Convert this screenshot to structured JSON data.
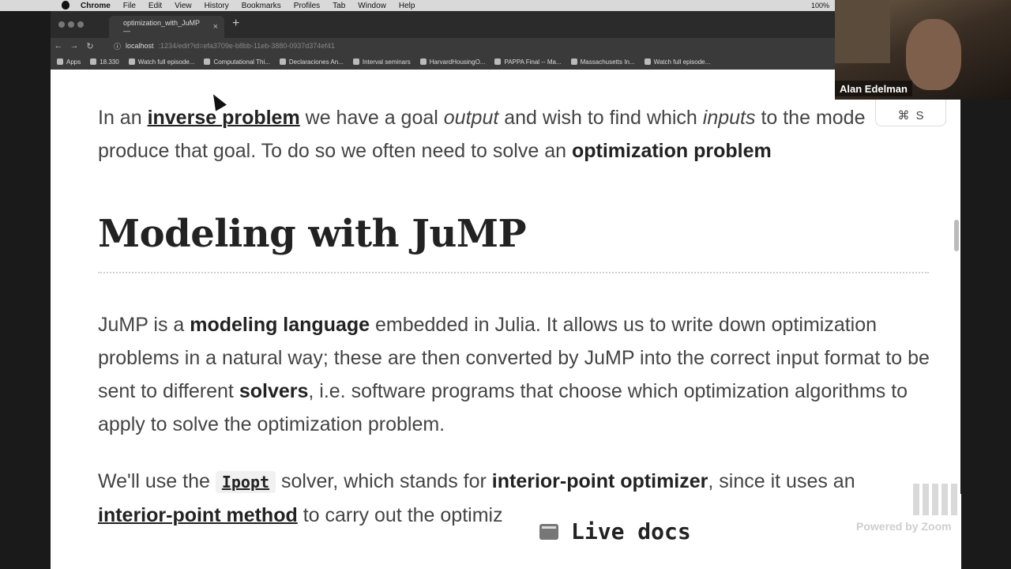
{
  "menubar": {
    "app_name": "Chrome",
    "items": [
      "File",
      "Edit",
      "View",
      "History",
      "Bookmarks",
      "Profiles",
      "Tab",
      "Window",
      "Help"
    ],
    "battery": "100%"
  },
  "tab": {
    "title": "optimization_with_JuMP —",
    "close": "×"
  },
  "new_tab": "+",
  "address": {
    "host": "localhost",
    "rest": ":1234/edit?id=efa3709e-b8bb-11eb-3880-0937d374ef41"
  },
  "bookmarks": [
    "Apps",
    "18.330",
    "Watch full episode...",
    "Computational Thi...",
    "Declaraciones An...",
    "Interval seminars",
    "HarvardHousingO...",
    "PAPPA Final -- Ma...",
    "Massachusetts In...",
    "Watch full episode..."
  ],
  "content": {
    "p1": {
      "t1": "In an ",
      "link1": "inverse problem",
      "t2": " we have a goal ",
      "i1": "output",
      "t3": " and wish to find which ",
      "i2": "inputs",
      "t4": " to the mode",
      "t5": "produce that goal. To do so we often need to solve an ",
      "b1": "optimization problem"
    },
    "heading": "Modeling with JuMP",
    "p2": {
      "t1": "JuMP is a ",
      "b1": "modeling language",
      "t2": " embedded in Julia. It allows us to write down optimization problems in a natural way; these are then converted by JuMP into the correct input format to be sent to different ",
      "b2": "solvers",
      "t3": ", i.e. software programs that choose which optimization algorithms to apply to solve the optimization problem."
    },
    "p3": {
      "t1": "We'll use the ",
      "code": "Ipopt",
      "t2": " solver, which stands for ",
      "b1": "interior-point optimizer",
      "t3": ", since it uses an ",
      "link1": "interior-point method",
      "t4": " to carry out the optimiz"
    }
  },
  "sidebar_toggle": {
    "symbol1": "⌘",
    "symbol2": "S"
  },
  "live_docs": {
    "label": "Live docs"
  },
  "webcam": {
    "name": "Alan Edelman"
  },
  "zoom_watermark": "Powered by Zoom"
}
